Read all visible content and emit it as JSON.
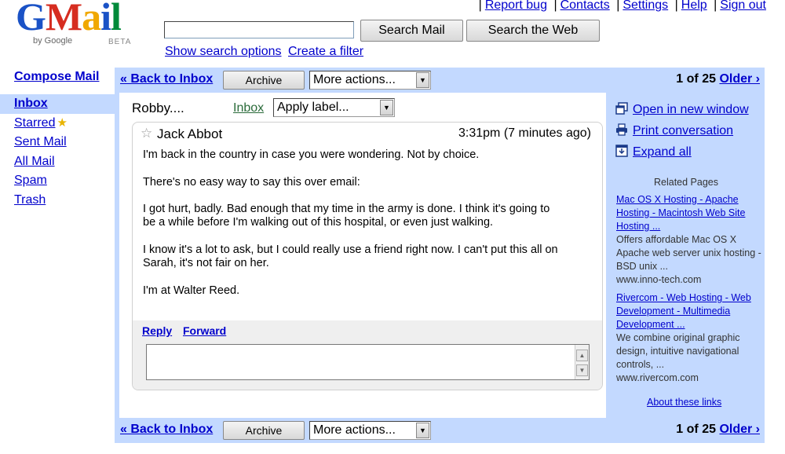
{
  "brand": {
    "logo_text": "Gmail",
    "by": "by Google",
    "beta": "BETA",
    "colors": {
      "accent": "#c3d9ff",
      "link": "#0000cc",
      "label_green": "#2a6b3a"
    }
  },
  "top_links": [
    "Report bug",
    "Contacts",
    "Settings",
    "Help",
    "Sign out"
  ],
  "search": {
    "value": "",
    "search_mail": "Search Mail",
    "search_web": "Search the Web",
    "show_options": "Show search options",
    "create_filter": "Create a filter"
  },
  "nav": {
    "compose": "Compose Mail",
    "items": [
      {
        "label": "Inbox",
        "selected": true
      },
      {
        "label": "Starred",
        "icon": "star-icon"
      },
      {
        "label": "Sent Mail"
      },
      {
        "label": "All Mail"
      },
      {
        "label": "Spam"
      },
      {
        "label": "Trash"
      }
    ]
  },
  "toolbar": {
    "back": "« Back to Inbox",
    "archive": "Archive",
    "more_actions": "More actions...",
    "paging_count": "1 of 25",
    "older": "Older ›"
  },
  "thread": {
    "subject": "Robby....",
    "label": "Inbox",
    "apply_label": "Apply label...",
    "message": {
      "sender": "Jack Abbot",
      "time": "3:31pm (7 minutes ago)",
      "paragraphs": [
        "I'm back in the country in case you were wondering. Not by choice.",
        "There's no easy way to say this over email:",
        "I got hurt, badly. Bad enough that my time in the army is done. I think it's going to be a while before I'm walking out of this hospital, or even just walking.",
        "I know it's a lot to ask, but I could really use a friend right now. I can't put this all on Sarah, it's not fair on her.",
        "I'm at Walter Reed."
      ],
      "reply": "Reply",
      "forward": "Forward",
      "reply_value": ""
    }
  },
  "right_pane": {
    "open_new_window": "Open in new window",
    "print": "Print conversation",
    "expand_all": "Expand all",
    "related_title": "Related Pages",
    "ads": [
      {
        "title": "Mac OS X Hosting - Apache Hosting - Macintosh Web Site Hosting ...",
        "desc": "Offers affordable Mac OS X Apache web server unix hosting - BSD unix ...",
        "url": "www.inno-tech.com"
      },
      {
        "title": "Rivercom - Web Hosting - Web Development - Multimedia Development ...",
        "desc": "We combine original graphic design, intuitive navigational controls, ...",
        "url": "www.rivercom.com"
      }
    ],
    "about": "About these links"
  }
}
